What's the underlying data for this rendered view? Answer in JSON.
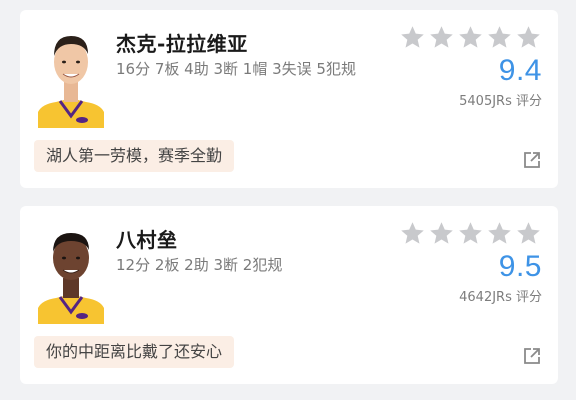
{
  "players": [
    {
      "name": "杰克-拉拉维亚",
      "stats": "16分 7板 4助 3断 1帽 3失误 5犯规",
      "score": "9.4",
      "votes": "5405JRs 评分",
      "comment": "湖人第一劳模，赛季全勤",
      "avatar": "player-headshot-icon",
      "skin": "#f0c7a6",
      "hair": "#2b2019",
      "jersey": "#f7c431",
      "jersey_trim": "#552583"
    },
    {
      "name": "八村垒",
      "stats": "12分 2板 2助 3断 2犯规",
      "score": "9.5",
      "votes": "4642JRs 评分",
      "comment": "你的中距离比戴了还安心",
      "avatar": "player-headshot-icon",
      "skin": "#6d4330",
      "hair": "#1b1411",
      "jersey": "#f7c431",
      "jersey_trim": "#552583"
    }
  ],
  "rating_icon": "star-icon",
  "share_icon": "share-icon",
  "colors": {
    "score": "#3e93e6",
    "star": "#c8c9cc",
    "comment_bg": "#fbeee5"
  }
}
